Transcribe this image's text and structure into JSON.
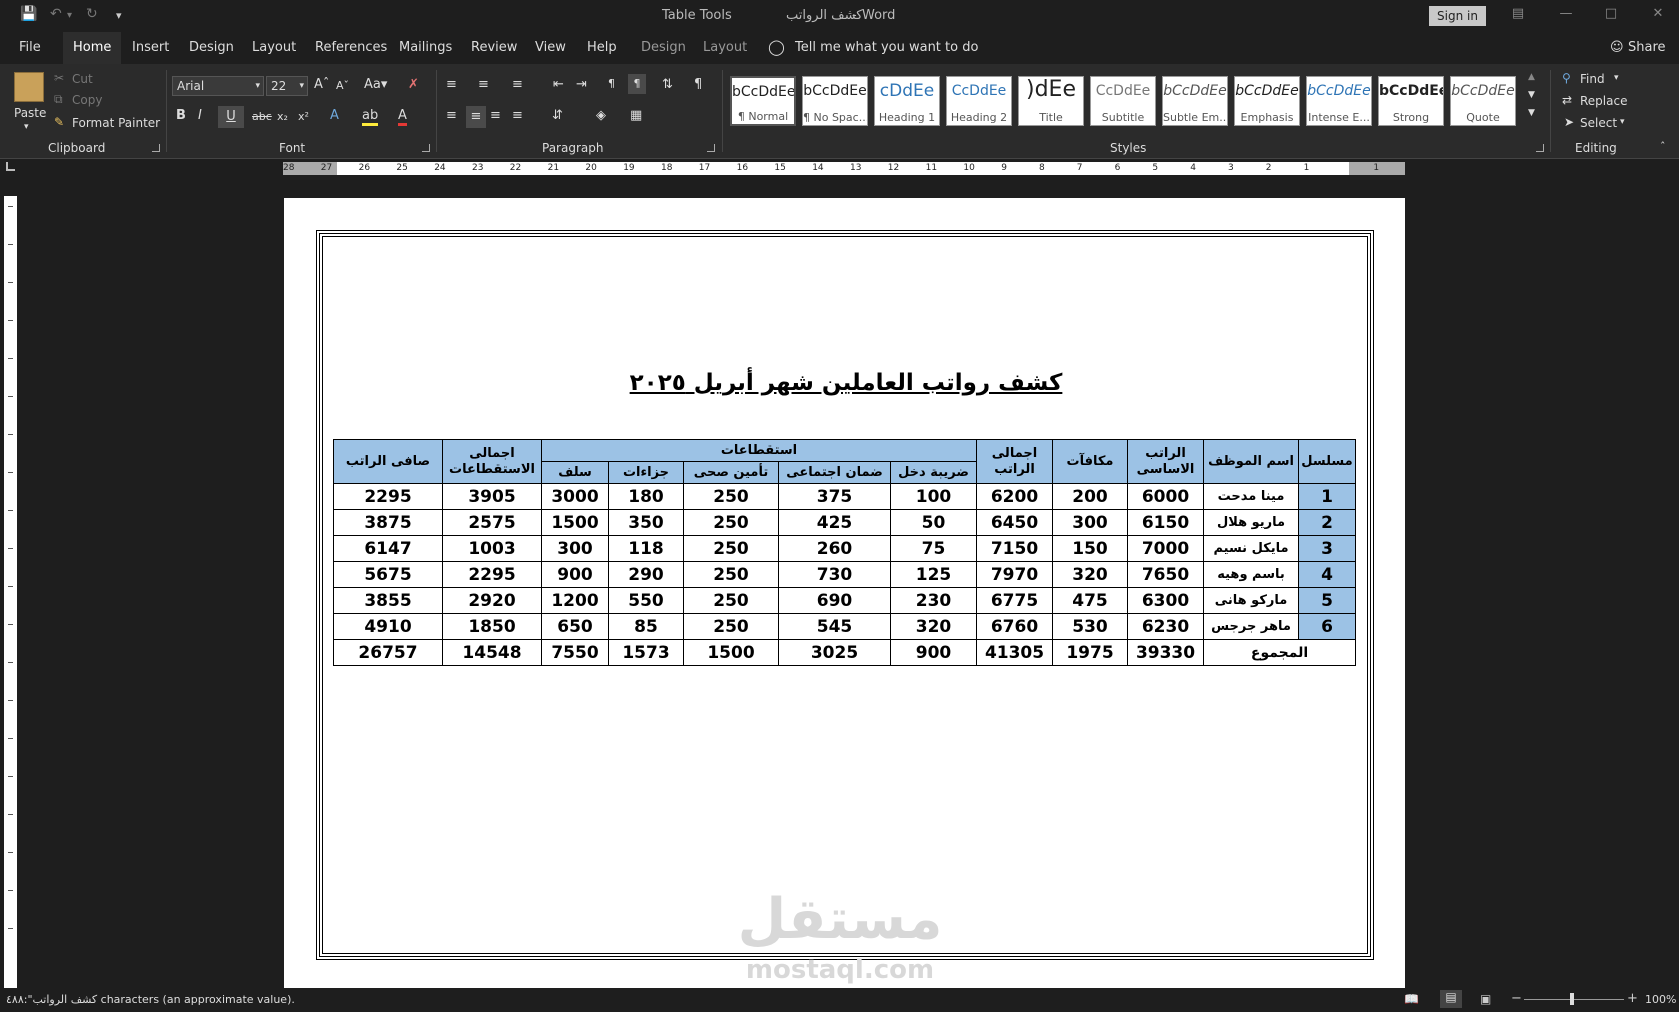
{
  "titlebar": {
    "context_group": "Table Tools",
    "doc_name": "كشف الرواتب",
    "app_name": "Word",
    "sign_in": "Sign in"
  },
  "menu": {
    "file": "File",
    "tabs": [
      "Home",
      "Insert",
      "Design",
      "Layout",
      "References",
      "Mailings",
      "Review",
      "View",
      "Help"
    ],
    "context_tabs": [
      "Design",
      "Layout"
    ],
    "tell_me": "Tell me what you want to do",
    "share": "Share"
  },
  "clipboard": {
    "label": "Clipboard",
    "paste": "Paste",
    "cut": "Cut",
    "copy": "Copy",
    "format_painter": "Format Painter"
  },
  "font": {
    "label": "Font",
    "family": "Arial",
    "size": "22"
  },
  "paragraph": {
    "label": "Paragraph"
  },
  "styles": {
    "label": "Styles",
    "items": [
      {
        "sample": "bCcDdEe",
        "name": "¶ Normal"
      },
      {
        "sample": "bCcDdEe",
        "name": "¶ No Spac..."
      },
      {
        "sample": "cDdEe",
        "name": "Heading 1"
      },
      {
        "sample": "CcDdEe",
        "name": "Heading 2"
      },
      {
        "sample": ")dEe",
        "name": "Title"
      },
      {
        "sample": "CcDdEe",
        "name": "Subtitle"
      },
      {
        "sample": "bCcDdEe",
        "name": "Subtle Em..."
      },
      {
        "sample": "bCcDdEe",
        "name": "Emphasis"
      },
      {
        "sample": "bCcDdEe",
        "name": "Intense E..."
      },
      {
        "sample": "bCcDdEe",
        "name": "Strong"
      },
      {
        "sample": "bCcDdEe",
        "name": "Quote"
      }
    ]
  },
  "editing": {
    "label": "Editing",
    "find": "Find",
    "replace": "Replace",
    "select": "Select"
  },
  "ruler": {
    "numbers": [
      "28",
      "27",
      "26",
      "25",
      "24",
      "23",
      "22",
      "21",
      "20",
      "19",
      "18",
      "17",
      "16",
      "15",
      "14",
      "13",
      "12",
      "11",
      "10",
      "9",
      "8",
      "7",
      "6",
      "5",
      "4",
      "3",
      "2",
      "1",
      "1"
    ]
  },
  "document": {
    "title": "كشف رواتب العاملين شهر أبريل ٢٠٢٥",
    "headers": {
      "serial": "مسلسل",
      "employee_name": "اسم الموظف",
      "basic_salary": "الراتب الاساسى",
      "bonuses": "مكافآت",
      "total_salary": "اجمالى الراتب",
      "deductions": "استقطاعات",
      "income_tax": "ضريبة دخل",
      "social_security": "ضمان اجتماعى",
      "health_insurance": "تأمين صحى",
      "penalties": "جزاءات",
      "advances": "سلف",
      "total_deductions": "اجمالى الاستقطاعات",
      "net_salary": "صافى الراتب"
    },
    "rows": [
      [
        "1",
        "مينا مدحت",
        "6000",
        "200",
        "6200",
        "100",
        "375",
        "250",
        "180",
        "3000",
        "3905",
        "2295"
      ],
      [
        "2",
        "ماريو هلال",
        "6150",
        "300",
        "6450",
        "50",
        "425",
        "250",
        "350",
        "1500",
        "2575",
        "3875"
      ],
      [
        "3",
        "مايكل نسيم",
        "7000",
        "150",
        "7150",
        "75",
        "260",
        "250",
        "118",
        "300",
        "1003",
        "6147"
      ],
      [
        "4",
        "باسم وهيه",
        "7650",
        "320",
        "7970",
        "125",
        "730",
        "250",
        "290",
        "900",
        "2295",
        "5675"
      ],
      [
        "5",
        "ماركو هانى",
        "6300",
        "475",
        "6775",
        "230",
        "690",
        "250",
        "550",
        "1200",
        "2920",
        "3855"
      ],
      [
        "6",
        "ماهر جرجس",
        "6230",
        "530",
        "6760",
        "320",
        "545",
        "250",
        "85",
        "650",
        "1850",
        "4910"
      ]
    ],
    "total_label": "المجموع",
    "totals": [
      "39330",
      "1975",
      "41305",
      "900",
      "3025",
      "1500",
      "1573",
      "7550",
      "14548",
      "26757"
    ]
  },
  "watermark": {
    "arabic": "مستقل",
    "latin": "mostaql.com"
  },
  "status": {
    "message": "كشف الرواتب\":٤٨٨ characters (an approximate value).",
    "zoom": "100%"
  }
}
